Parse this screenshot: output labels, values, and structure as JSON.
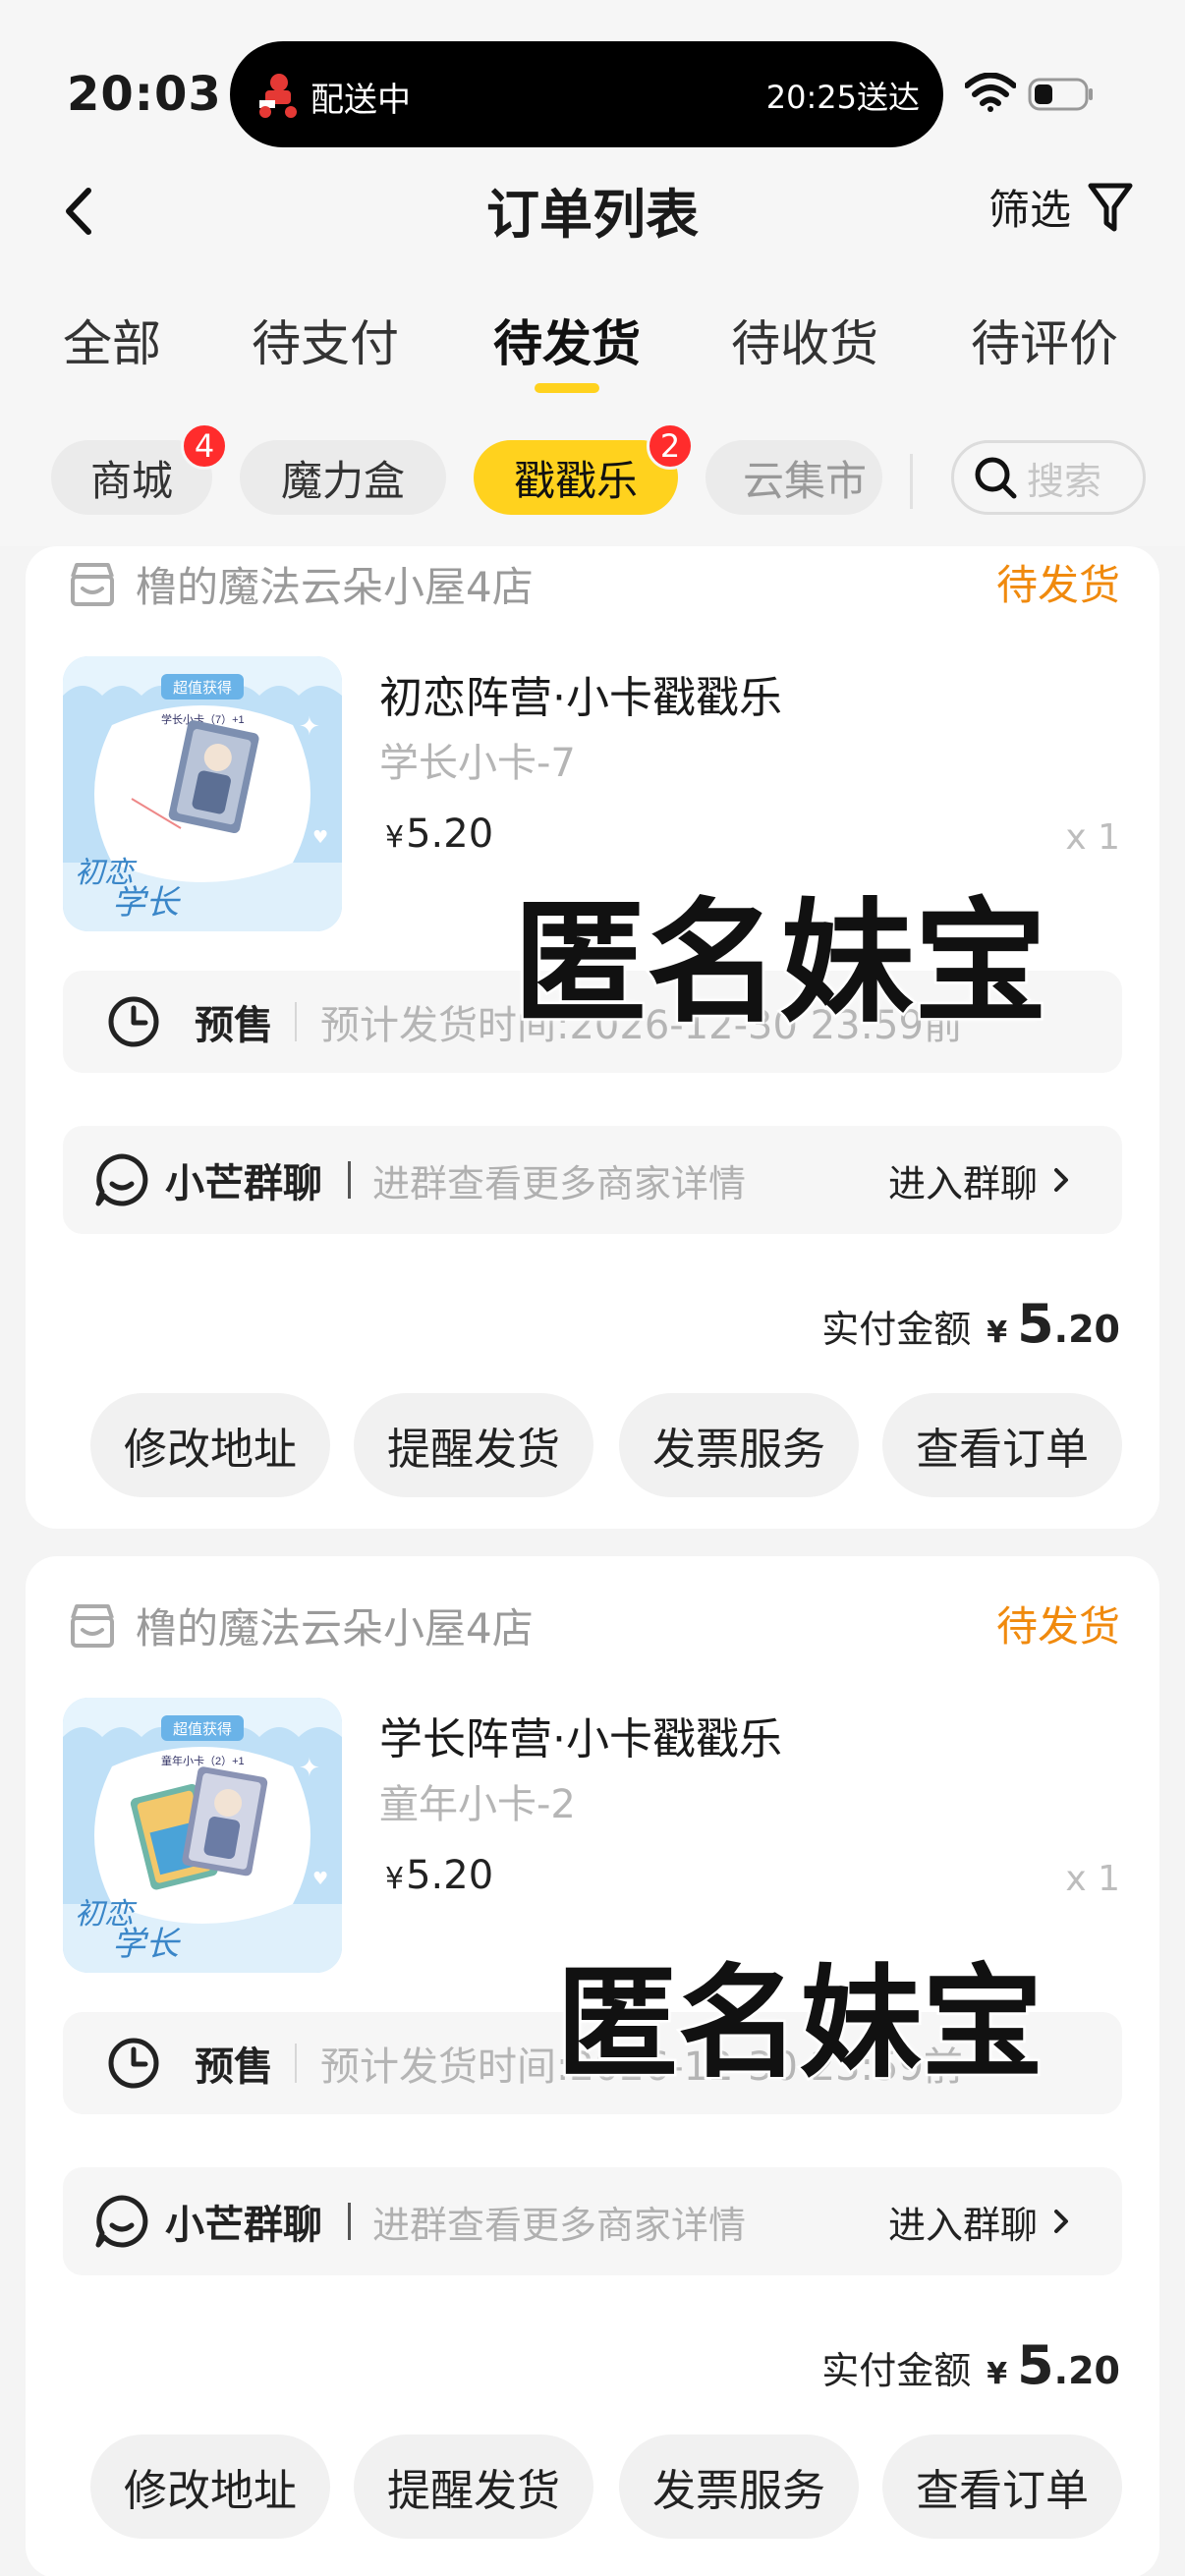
{
  "status_bar": {
    "time": "20:03",
    "live_activity": {
      "label": "配送中",
      "eta": "20:25送达"
    }
  },
  "nav": {
    "title": "订单列表",
    "filter_label": "筛选"
  },
  "tabs": [
    {
      "label": "全部"
    },
    {
      "label": "待支付"
    },
    {
      "label": "待发货",
      "active": true
    },
    {
      "label": "待收货"
    },
    {
      "label": "待评价"
    }
  ],
  "chips": [
    {
      "label": "商城",
      "badge": "4"
    },
    {
      "label": "魔力盒"
    },
    {
      "label": "戳戳乐",
      "badge": "2",
      "active": true
    },
    {
      "label": "云集市"
    }
  ],
  "search": {
    "placeholder": "搜索"
  },
  "orders": [
    {
      "shop": "橹的魔法云朵小屋4店",
      "status": "待发货",
      "product_name": "初恋阵营·小卡戳戳乐",
      "variant": "学长小卡-7",
      "price_symbol": "¥",
      "price": "5.20",
      "quantity": "x 1",
      "presale_label": "预售",
      "presale_eta": "预计发货时间:2026-12-30 23:59前",
      "group_name": "小芒群聊",
      "group_desc": "进群查看更多商家详情",
      "group_enter": "进入群聊",
      "paid_label": "实付金额",
      "paid_symbol": "¥",
      "paid_int": "5",
      "paid_dec": ".20",
      "buttons": [
        "修改地址",
        "提醒发货",
        "发票服务",
        "查看订单"
      ],
      "thumb": {
        "badge": "超值获得",
        "card_caption": "学长小卡（7）+1"
      }
    },
    {
      "shop": "橹的魔法云朵小屋4店",
      "status": "待发货",
      "product_name": "学长阵营·小卡戳戳乐",
      "variant": "童年小卡-2",
      "price_symbol": "¥",
      "price": "5.20",
      "quantity": "x 1",
      "presale_label": "预售",
      "presale_eta": "预计发货时间:2026-12-30 23:59前",
      "group_name": "小芒群聊",
      "group_desc": "进群查看更多商家详情",
      "group_enter": "进入群聊",
      "paid_label": "实付金额",
      "paid_symbol": "¥",
      "paid_int": "5",
      "paid_dec": ".20",
      "buttons": [
        "修改地址",
        "提醒发货",
        "发票服务",
        "查看订单"
      ],
      "thumb": {
        "badge": "超值获得",
        "card_caption": "童年小卡（2）+1"
      }
    }
  ],
  "watermark": "匿名妹宝",
  "colors": {
    "accent_yellow": "#ffd21e",
    "status_orange": "#f08a0e",
    "badge_red": "#ff2c2c",
    "page_bg": "#f4f4f4"
  }
}
